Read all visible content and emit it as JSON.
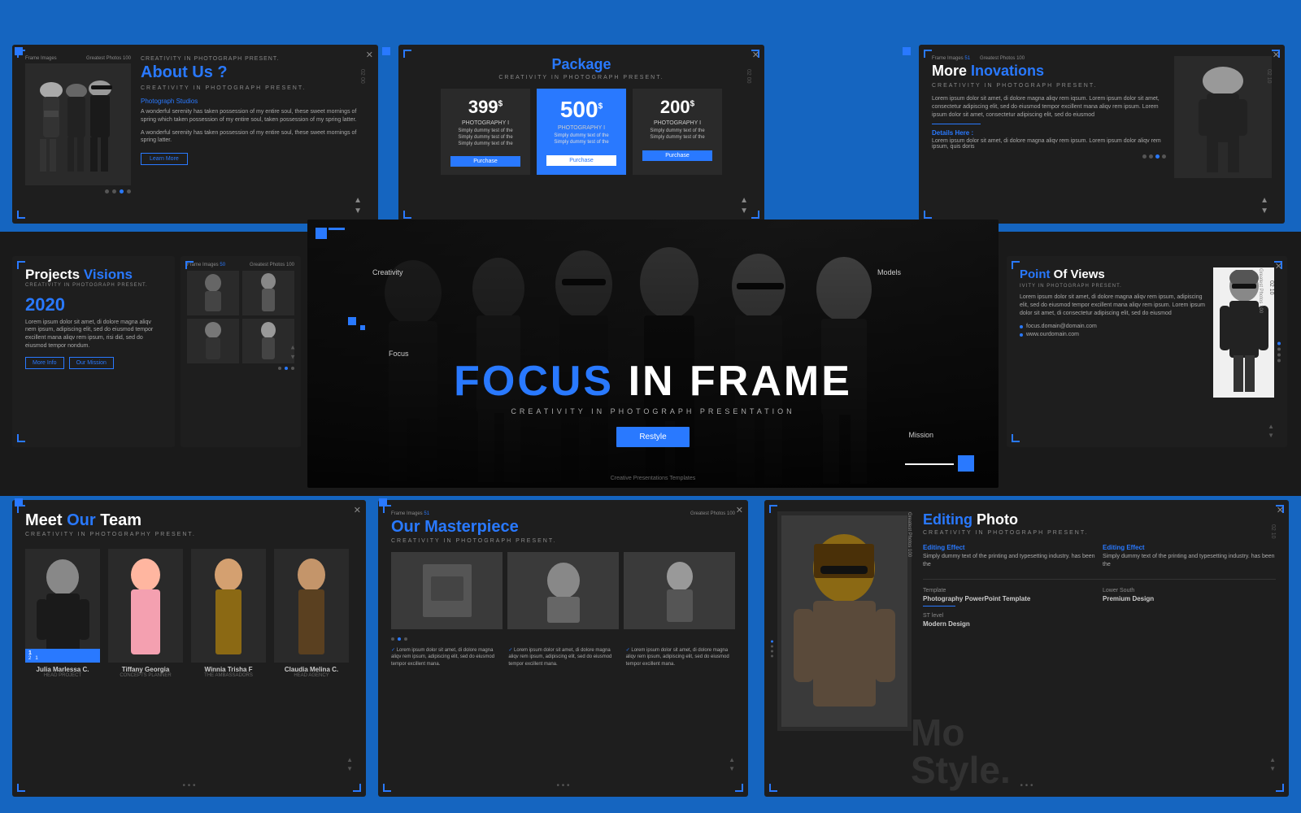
{
  "slides": {
    "about": {
      "title": "About Us ?",
      "subtitle": "CREATIVITY IN PHOTOGRAPH PRESENT.",
      "link": "Photograph Studios",
      "body1": "A wonderful serenity has taken possession of my entire soul, these sweet mornings of spring which taken possession of my entire soul, taken possession of my spring latter.",
      "body2": "A wonderful serenity has taken possession of my entire soul, these sweet mornings of spring latter.",
      "btn": "Learn More",
      "label": "Frame Images",
      "label2": "Greatest Photos 100"
    },
    "package": {
      "title": "Package",
      "subtitle": "CREATIVITY IN PHOTOGRAPH PRESENT.",
      "plans": [
        {
          "price": "399",
          "currency": "$",
          "name": "PHOTOGRAPHY I",
          "desc": "Simply dummy text of the Simply dummy test of the Simply dummy text of the",
          "btn": "Purchase",
          "featured": false
        },
        {
          "price": "500",
          "currency": "$",
          "name": "PHOTOGRAPHY I",
          "desc": "Simply dummy text of the Simply dummy test of the",
          "btn": "Purchase",
          "featured": true
        },
        {
          "price": "200",
          "currency": "$",
          "name": "PHOTOGRAPHY I",
          "desc": "Simply dummy text of the Simply dummy test of the",
          "btn": "Purchase",
          "featured": false
        }
      ]
    },
    "innovations": {
      "title": "More",
      "title2": "Inovations",
      "subtitle": "CREATIVITY IN PHOTOGRAPH PRESENT.",
      "body": "Lorem ipsum dolor sit amet, di dolore magna aliqv rem iqsum. Lorem ipsum dolor sit amet, consectetur adipiscing elit, sed do eiusmod tempor excillent mana aliqv rem ipsum. Lorem ipsum dolor sit amet, consectetur adipiscing elit, sed do eiusmod",
      "details_label": "Details Here :",
      "details_body": "Lorem ipsum dolor sit amet, di dolore magna aliqv rem ipsum. Lorem ipsum dolor aliqv rem ipsum, quis doris",
      "label1": "Frame Images",
      "label2": "Greatest Photos 100"
    },
    "hero": {
      "main_title_blue": "FOCUS",
      "main_title_white": "IN FRAME",
      "tagline": "CREATIVITY IN PHOTOGRAPH PRESENTATION",
      "btn": "Restyle",
      "footer": "Creative Presentations Templates",
      "labels": [
        "Creativity",
        "Focus",
        "Models",
        "Mission"
      ]
    },
    "projects": {
      "title_white": "Projects",
      "title_blue": "Visions",
      "subtitle": "CREATIVITY IN PHOTOGRAPH PRESENT.",
      "year": "2020",
      "body": "Lorem ipsum dolor sit amet, di dolore magna aliqv nem ipsum, adipiscing elit, sed do eiusmod tempor excillent mana aliqv rem ipsum, risi did, sed do eiusmod tempor nondum.",
      "btn1": "More Info",
      "btn2": "Our Mission"
    },
    "pov": {
      "title_blue": "Point",
      "title_white": "Of Views",
      "subtitle": "ITY IN PHOTOGRAPH PRESENT.",
      "body": "Lorem ipsum dolor sit amet, di dolore magna aliqv rem ipsum, adipiscing elit, sed do eiusmod tempor excillent mana aliqv rem ipsum. Lorem ipsum dolor sit amet, di consectetur adipiscing elit, sed do eiusmod",
      "email": "focus.domain@domain.com",
      "website": "www.ourdomain.com"
    },
    "team": {
      "title_white": "Meet",
      "title_blue": "Our",
      "title_white2": "Team",
      "subtitle": "CREATIVITY IN PHOTOGRAPHY PRESENT.",
      "members": [
        {
          "name": "Julia Marlessa C.",
          "role": "HEAD PROJECT",
          "featured": true
        },
        {
          "name": "Tiffany Georgia",
          "role": "CONCEPTS PLANNER",
          "featured": false
        },
        {
          "name": "Winnia Trisha F",
          "role": "THE AMBASSADORS",
          "featured": false
        },
        {
          "name": "Claudia Melina C.",
          "role": "HEAD AGENCY",
          "featured": false
        }
      ]
    },
    "masterpiece": {
      "title": "Our Masterpiece",
      "subtitle": "CREATIVITY IN PHOTOGRAPH PRESENT.",
      "label1": "Frame Images",
      "label2": "Greatest Photos 100",
      "bullets": [
        "Lorem ipsum dolor sit amet, di dolore magna aliqv rem ipsum, adipiscing elit, sed do eiusmod tempor excillent mana.",
        "Lorem ipsum dolor sit amet, di dolore magna aliqv rem ipsum, adipiscing elit, sed do eiusmod tempor excillent mana.",
        "Lorem ipsum dolor sit amet, di dolore magna aliqv rem ipsum, adipiscing elit, sed do eiusmod tempor excillent mana."
      ]
    },
    "editing": {
      "title_blue": "Editing",
      "title_white": "Photo",
      "subtitle": "CREATIVITY IN PHOTOGRAPH PRESENT.",
      "effect1_label": "Editing Effect",
      "effect1_text": "Simply dummy text of the printing and typesetting industry. has been the",
      "effect2_label": "Editing Effect",
      "effect2_text": "Simply dummy text of the printing and typesetting industry. has been the",
      "template_label": "Template",
      "template_val": "Photography PowerPoint Template",
      "style_label": "Lower South",
      "style_val": "Premium Design",
      "design_label": "ST level",
      "design_val": "Modern Design",
      "big_text1": "Mo",
      "big_text2": "Style."
    }
  },
  "colors": {
    "accent": "#2979FF",
    "dark_bg": "#1e1e1e",
    "blue_strip": "#1565C0"
  }
}
